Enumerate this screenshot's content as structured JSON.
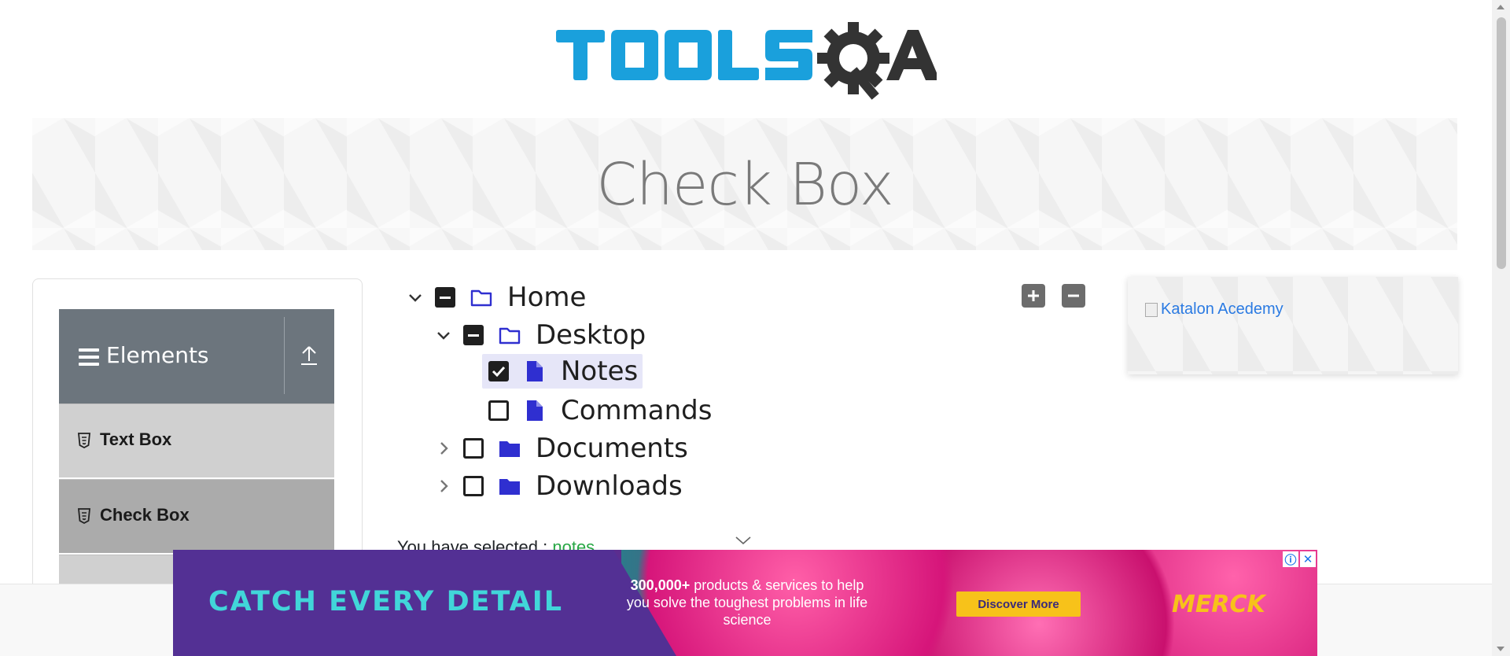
{
  "header": {
    "logo_alt": "TOOLSQA"
  },
  "banner": {
    "title": "Check Box"
  },
  "sidebar": {
    "group_label": "Elements",
    "items": [
      {
        "label": "Text Box"
      },
      {
        "label": "Check Box"
      },
      {
        "label": ""
      }
    ]
  },
  "tree": {
    "nodes": [
      {
        "label": "Home",
        "state": "partial",
        "expanded": true,
        "type": "folder"
      },
      {
        "label": "Desktop",
        "state": "partial",
        "expanded": true,
        "type": "folder"
      },
      {
        "label": "Notes",
        "state": "checked",
        "type": "file"
      },
      {
        "label": "Commands",
        "state": "unchecked",
        "type": "file"
      },
      {
        "label": "Documents",
        "state": "unchecked",
        "expanded": false,
        "type": "folder"
      },
      {
        "label": "Downloads",
        "state": "unchecked",
        "expanded": false,
        "type": "folder"
      }
    ],
    "expand_all_icon": "plus-square-icon",
    "collapse_all_icon": "minus-square-icon"
  },
  "result": {
    "prefix": "You have selected :",
    "value": "notes"
  },
  "side_ad": {
    "alt_text": "Katalon Acedemy"
  },
  "bottom_ad": {
    "headline": "CATCH EVERY DETAIL",
    "copy_bold": "300,000+",
    "copy_rest": " products & services to help you solve the toughest problems in life science",
    "cta": "Discover More",
    "brand": "MERCK"
  },
  "colors": {
    "sidebar_header": "#6c757d",
    "folder_icon": "#2f2fd0",
    "result_value": "#28a745",
    "logo_blue": "#1aa0dc",
    "logo_dark": "#333333"
  }
}
